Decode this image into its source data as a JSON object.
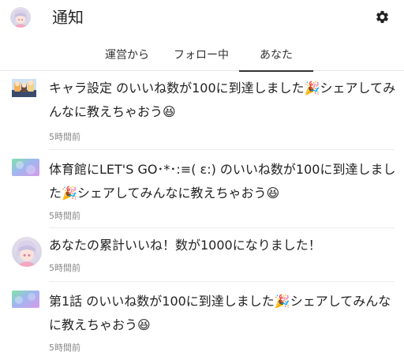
{
  "header": {
    "title": "通知",
    "avatar_icon": "user-avatar",
    "settings_icon": "gear-icon"
  },
  "tabs": [
    {
      "label": "運営から",
      "active": false
    },
    {
      "label": "フォロー中",
      "active": false
    },
    {
      "label": "あなた",
      "active": true
    }
  ],
  "notifications": [
    {
      "thumbnail": "story-thumbnail-illustration",
      "text": "キャラ設定 のいいね数が100に到達しました🎉シェアしてみんなに教えちゃおう😆",
      "time": "5時間前"
    },
    {
      "thumbnail": "story-thumbnail-gradient",
      "text": "体育館にLET'S GO･*･:≡( ε:) のいいね数が100に到達しました🎉シェアしてみんなに教えちゃおう😆",
      "time": "5時間前"
    },
    {
      "thumbnail": "user-avatar",
      "text": "あなたの累計いいね！数が1000になりました！",
      "time": "5時間前"
    },
    {
      "thumbnail": "story-thumbnail-gradient",
      "text": "第1話 のいいね数が100に到達しました🎉シェアしてみんなに教えちゃおう😆",
      "time": "5時間前"
    }
  ],
  "colors": {
    "text": "#222222",
    "muted": "#888888",
    "divider": "#ececec",
    "active_tab_indicator": "#333333"
  }
}
